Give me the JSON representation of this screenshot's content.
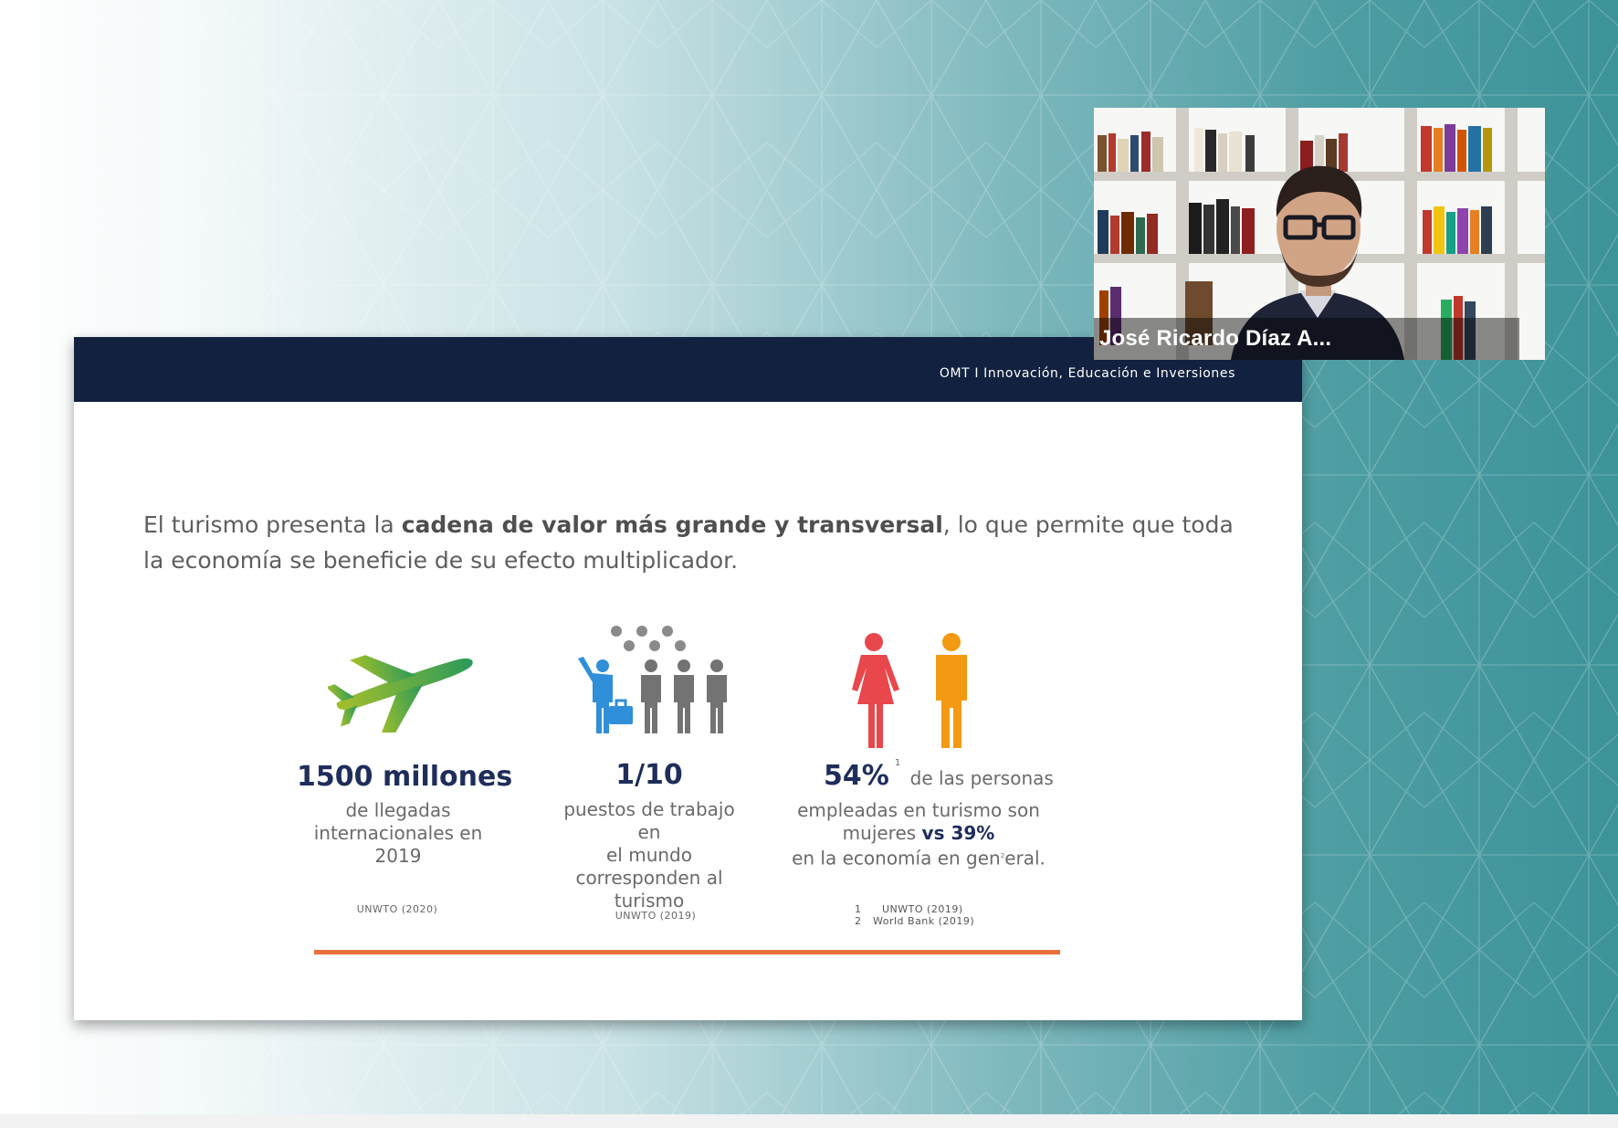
{
  "slide": {
    "header": "OMT I Innovación, Educación e Inversiones",
    "intro": {
      "part1": "El turismo presenta la ",
      "bold": "cadena de valor más grande y transversal",
      "part2": ", lo que permite que toda la economía se beneficie de su efecto multiplicador."
    },
    "stats": [
      {
        "icon": "airplane-icon",
        "value": "1500 millones",
        "lines": [
          "de llegadas",
          "internacionales en",
          "2019"
        ],
        "source": "UNWTO (2020)"
      },
      {
        "icon": "people-group-icon",
        "value": "1/10",
        "lines": [
          "puestos de trabajo en",
          "el mundo",
          "corresponden al",
          "turismo"
        ],
        "source": "UNWTO (2019)"
      },
      {
        "icon": "woman-man-icon",
        "value": "54%",
        "value_sup": "1",
        "value_suffix": "de las personas",
        "line1": "empleadas en turismo son",
        "line2_pre": "mujeres",
        "line2_bold": "vs 39%",
        "line3_pre": "en la economía en gen",
        "line3_sup": "2",
        "line3_post": "eral.",
        "sources": [
          {
            "num": "1",
            "text": "UNWTO (2019)"
          },
          {
            "num": "2",
            "text": "World Bank (2019)"
          }
        ]
      }
    ]
  },
  "video": {
    "participant_name": "José Ricardo Díaz A..."
  },
  "colors": {
    "header_navy": "#12213f",
    "accent_orange": "#e8703a",
    "woman_red": "#e8474c",
    "man_orange": "#f39a12",
    "worker_blue": "#2f8fd8"
  }
}
